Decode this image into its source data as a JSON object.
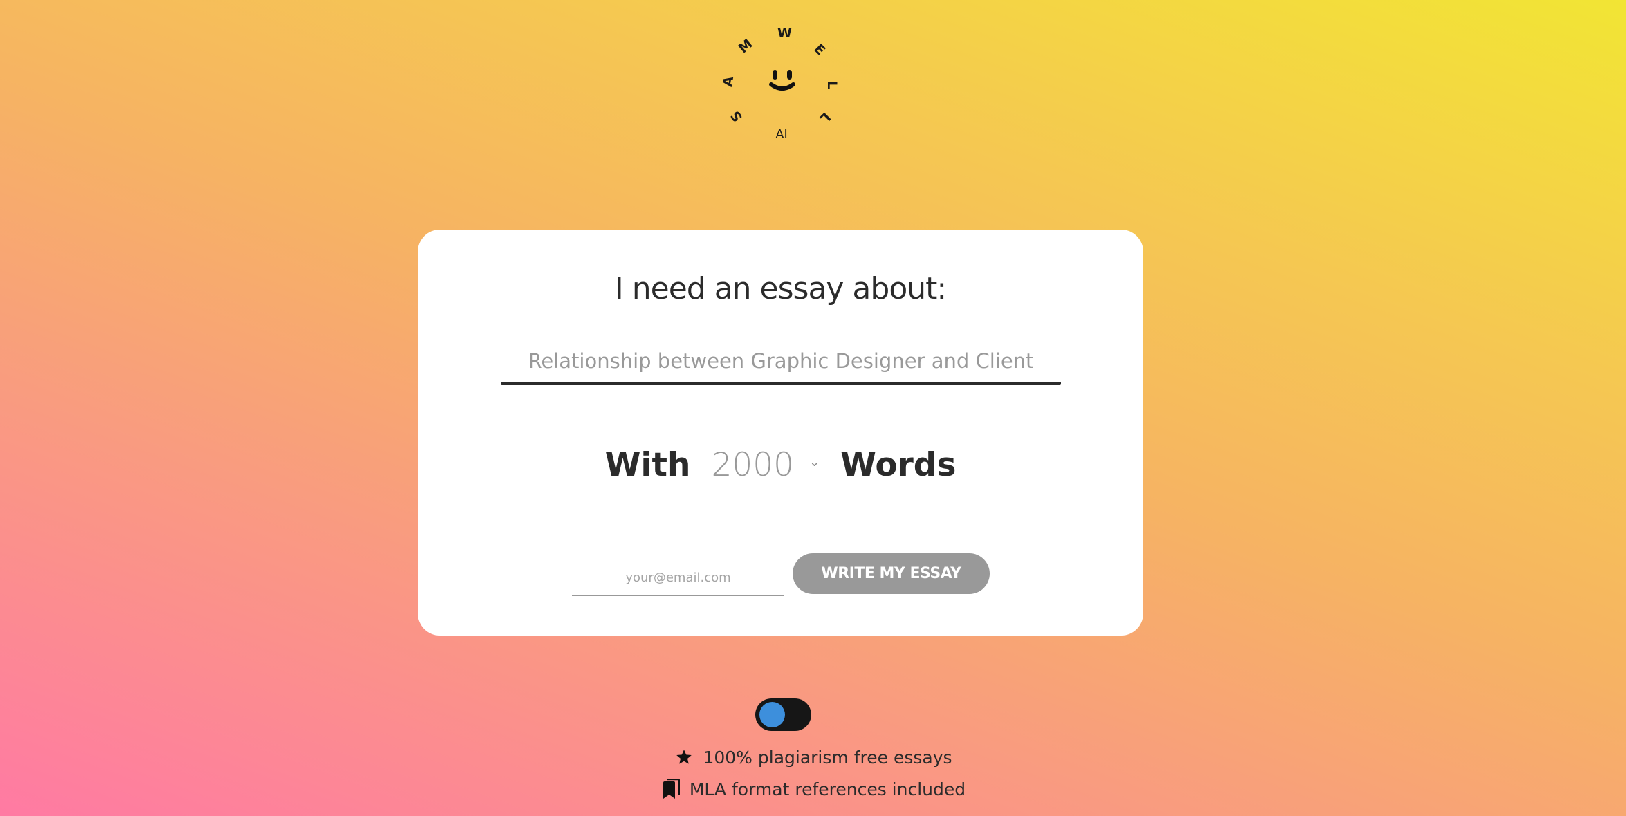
{
  "logo": {
    "ring_letters": [
      "S",
      "A",
      "M",
      "W",
      "E",
      "L",
      "L"
    ],
    "sub_label": "AI",
    "center_icon": "smiley-icon"
  },
  "form": {
    "heading": "I need an essay about:",
    "topic": {
      "value": "",
      "placeholder": "Relationship between Graphic Designer and Client"
    },
    "words": {
      "prefix": "With",
      "selected": "2000",
      "suffix": "Words",
      "chevron_icon": "chevron-down-icon"
    },
    "email": {
      "value": "",
      "placeholder": "your@email.com"
    },
    "submit_label": "WRITE MY ESSAY"
  },
  "toggle": {
    "state": "off",
    "knob_color": "#3d8fdc",
    "track_color": "#161616"
  },
  "features": [
    {
      "icon": "star-icon",
      "text": "100% plagiarism free essays"
    },
    {
      "icon": "bookmarks-icon",
      "text": "MLA format references included"
    }
  ],
  "colors": {
    "gradient_top_right": "#f2e534",
    "gradient_top_left": "#f5c752",
    "gradient_bottom_left": "#ff7aa3",
    "gradient_bottom_right": "#f99b80",
    "button_bg": "#999999",
    "text_dark": "#2b2b2b"
  }
}
